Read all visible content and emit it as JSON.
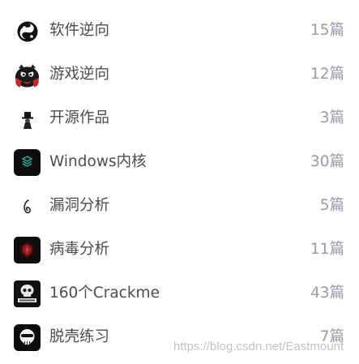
{
  "columns": [
    {
      "name": "软件逆向",
      "count": "15篇",
      "icon": "swirl-logo-icon"
    },
    {
      "name": "游戏逆向",
      "count": "12篇",
      "icon": "angry-bird-icon"
    },
    {
      "name": "开源作品",
      "count": "3篇",
      "icon": "top-hat-figure-icon"
    },
    {
      "name": "Windows内核",
      "count": "30篇",
      "icon": "layered-chip-icon"
    },
    {
      "name": "漏洞分析",
      "count": "5篇",
      "icon": "spiral-sketch-icon"
    },
    {
      "name": "病毒分析",
      "count": "11篇",
      "icon": "red-emblem-icon"
    },
    {
      "name": "160个Crackme",
      "count": "43篇",
      "icon": "skull-badge-icon"
    },
    {
      "name": "脱壳练习",
      "count": "7篇",
      "icon": "skull-mask-icon"
    }
  ],
  "watermark": "https://blog.csdn.net/Eastmount"
}
